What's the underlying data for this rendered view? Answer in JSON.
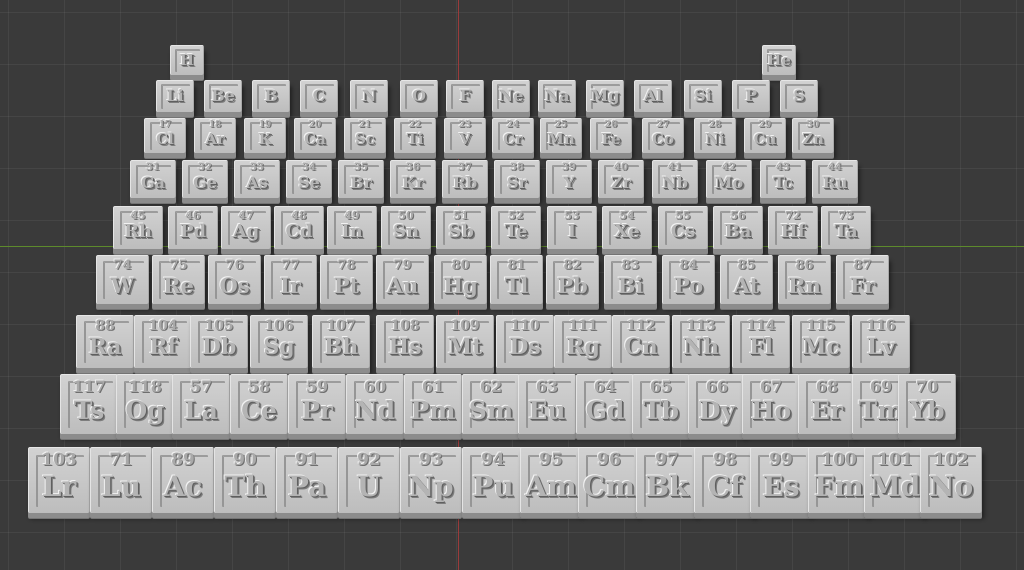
{
  "viewport": {
    "grid_color": "#444444",
    "background": "#3a3a3a",
    "x_axis_color": "#5d8a2c",
    "y_axis_color": "#9a3b3b"
  },
  "rows": [
    [
      {
        "n": "",
        "s": "H"
      },
      {
        "n": "",
        "s": "He"
      }
    ],
    [
      {
        "n": "",
        "s": "Li"
      },
      {
        "n": "",
        "s": "Be"
      },
      {
        "n": "",
        "s": "B"
      },
      {
        "n": "",
        "s": "C"
      },
      {
        "n": "",
        "s": "N"
      },
      {
        "n": "",
        "s": "O"
      },
      {
        "n": "",
        "s": "F"
      },
      {
        "n": "",
        "s": "Ne"
      },
      {
        "n": "",
        "s": "Na"
      },
      {
        "n": "",
        "s": "Mg"
      },
      {
        "n": "",
        "s": "Al"
      },
      {
        "n": "",
        "s": "Si"
      },
      {
        "n": "",
        "s": "P"
      },
      {
        "n": "",
        "s": "S"
      }
    ],
    [
      {
        "n": "17",
        "s": "Cl"
      },
      {
        "n": "18",
        "s": "Ar"
      },
      {
        "n": "19",
        "s": "K"
      },
      {
        "n": "20",
        "s": "Ca"
      },
      {
        "n": "21",
        "s": "Sc"
      },
      {
        "n": "22",
        "s": "Ti"
      },
      {
        "n": "23",
        "s": "V"
      },
      {
        "n": "24",
        "s": "Cr"
      },
      {
        "n": "25",
        "s": "Mn"
      },
      {
        "n": "26",
        "s": "Fe"
      },
      {
        "n": "27",
        "s": "Co"
      },
      {
        "n": "28",
        "s": "Ni"
      },
      {
        "n": "29",
        "s": "Cu"
      },
      {
        "n": "30",
        "s": "Zn"
      }
    ],
    [
      {
        "n": "31",
        "s": "Ga"
      },
      {
        "n": "32",
        "s": "Ge"
      },
      {
        "n": "33",
        "s": "As"
      },
      {
        "n": "34",
        "s": "Se"
      },
      {
        "n": "35",
        "s": "Br"
      },
      {
        "n": "36",
        "s": "Kr"
      },
      {
        "n": "37",
        "s": "Rb"
      },
      {
        "n": "38",
        "s": "Sr"
      },
      {
        "n": "39",
        "s": "Y"
      },
      {
        "n": "40",
        "s": "Zr"
      },
      {
        "n": "41",
        "s": "Nb"
      },
      {
        "n": "42",
        "s": "Mo"
      },
      {
        "n": "43",
        "s": "Tc"
      },
      {
        "n": "44",
        "s": "Ru"
      }
    ],
    [
      {
        "n": "45",
        "s": "Rh"
      },
      {
        "n": "46",
        "s": "Pd"
      },
      {
        "n": "47",
        "s": "Ag"
      },
      {
        "n": "48",
        "s": "Cd"
      },
      {
        "n": "49",
        "s": "In"
      },
      {
        "n": "50",
        "s": "Sn"
      },
      {
        "n": "51",
        "s": "Sb"
      },
      {
        "n": "52",
        "s": "Te"
      },
      {
        "n": "53",
        "s": "I"
      },
      {
        "n": "54",
        "s": "Xe"
      },
      {
        "n": "55",
        "s": "Cs"
      },
      {
        "n": "56",
        "s": "Ba"
      },
      {
        "n": "72",
        "s": "Hf"
      },
      {
        "n": "73",
        "s": "Ta"
      }
    ],
    [
      {
        "n": "74",
        "s": "W"
      },
      {
        "n": "75",
        "s": "Re"
      },
      {
        "n": "76",
        "s": "Os"
      },
      {
        "n": "77",
        "s": "Ir"
      },
      {
        "n": "78",
        "s": "Pt"
      },
      {
        "n": "79",
        "s": "Au"
      },
      {
        "n": "80",
        "s": "Hg"
      },
      {
        "n": "81",
        "s": "Tl"
      },
      {
        "n": "82",
        "s": "Pb"
      },
      {
        "n": "83",
        "s": "Bi"
      },
      {
        "n": "84",
        "s": "Po"
      },
      {
        "n": "85",
        "s": "At"
      },
      {
        "n": "86",
        "s": "Rn"
      },
      {
        "n": "87",
        "s": "Fr"
      }
    ],
    [
      {
        "n": "88",
        "s": "Ra"
      },
      {
        "n": "104",
        "s": "Rf"
      },
      {
        "n": "105",
        "s": "Db"
      },
      {
        "n": "106",
        "s": "Sg"
      },
      {
        "n": "107",
        "s": "Bh"
      },
      {
        "n": "108",
        "s": "Hs"
      },
      {
        "n": "109",
        "s": "Mt"
      },
      {
        "n": "110",
        "s": "Ds"
      },
      {
        "n": "111",
        "s": "Rg"
      },
      {
        "n": "112",
        "s": "Cn"
      },
      {
        "n": "113",
        "s": "Nh"
      },
      {
        "n": "114",
        "s": "Fl"
      },
      {
        "n": "115",
        "s": "Mc"
      },
      {
        "n": "116",
        "s": "Lv"
      }
    ],
    [
      {
        "n": "117",
        "s": "Ts"
      },
      {
        "n": "118",
        "s": "Og"
      },
      {
        "n": "57",
        "s": "La"
      },
      {
        "n": "58",
        "s": "Ce"
      },
      {
        "n": "59",
        "s": "Pr"
      },
      {
        "n": "60",
        "s": "Nd"
      },
      {
        "n": "61",
        "s": "Pm"
      },
      {
        "n": "62",
        "s": "Sm"
      },
      {
        "n": "63",
        "s": "Eu"
      },
      {
        "n": "64",
        "s": "Gd"
      },
      {
        "n": "65",
        "s": "Tb"
      },
      {
        "n": "66",
        "s": "Dy"
      },
      {
        "n": "67",
        "s": "Ho"
      },
      {
        "n": "68",
        "s": "Er"
      },
      {
        "n": "69",
        "s": "Tm"
      },
      {
        "n": "70",
        "s": "Yb"
      }
    ],
    [
      {
        "n": "103",
        "s": "Lr"
      },
      {
        "n": "71",
        "s": "Lu"
      },
      {
        "n": "89",
        "s": "Ac"
      },
      {
        "n": "90",
        "s": "Th"
      },
      {
        "n": "91",
        "s": "Pa"
      },
      {
        "n": "92",
        "s": "U"
      },
      {
        "n": "93",
        "s": "Np"
      },
      {
        "n": "94",
        "s": "Pu"
      },
      {
        "n": "95",
        "s": "Am"
      },
      {
        "n": "96",
        "s": "Cm"
      },
      {
        "n": "97",
        "s": "Bk"
      },
      {
        "n": "98",
        "s": "Cf"
      },
      {
        "n": "99",
        "s": "Es"
      },
      {
        "n": "100",
        "s": "Fm"
      },
      {
        "n": "101",
        "s": "Md"
      },
      {
        "n": "102",
        "s": "No"
      }
    ]
  ]
}
